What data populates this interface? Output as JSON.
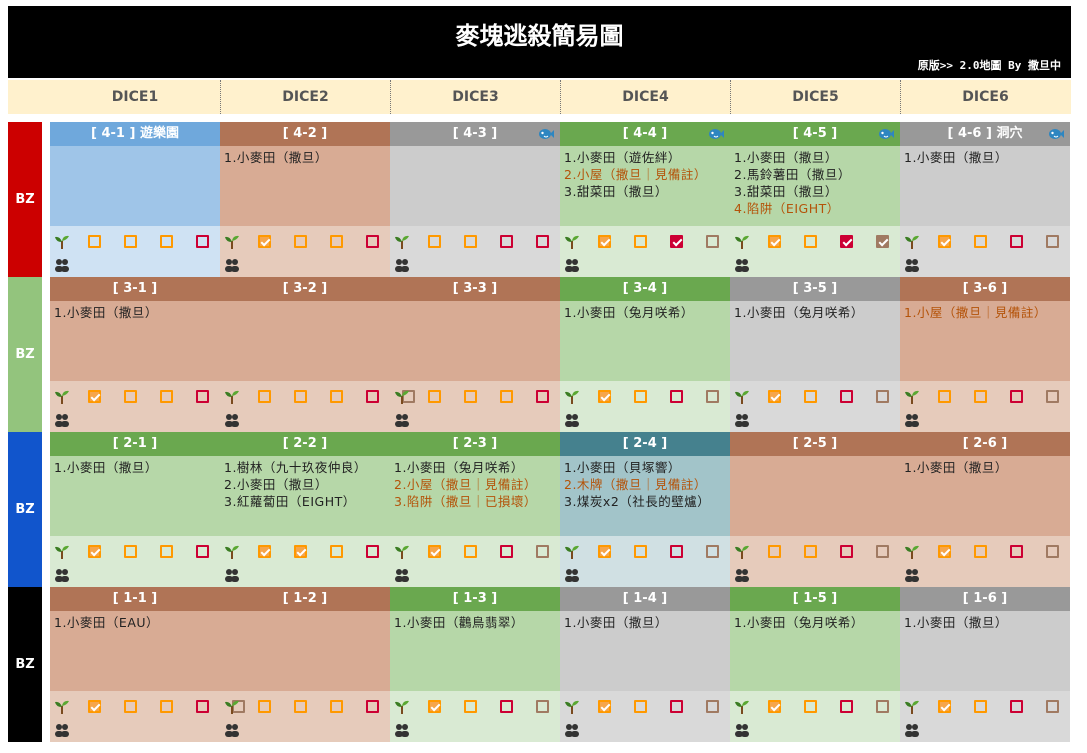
{
  "page": {
    "title": "麥塊逃殺簡易圖",
    "credit": "原版>> 2.0地圖 By 撒旦中"
  },
  "dice": [
    "DICE1",
    "DICE2",
    "DICE3",
    "DICE4",
    "DICE5",
    "DICE6"
  ],
  "colors": {
    "blue_hdr": "#6fa8dc",
    "blue_body": "#9fc5e8",
    "blue_foot": "#cfe2f3",
    "brown_hdr": "#b07456",
    "brown_body": "#d8ab94",
    "brown_foot": "#e6cbbb",
    "gray_hdr": "#999999",
    "gray_body": "#cccccc",
    "gray_foot": "#d9d9d9",
    "green_hdr": "#6aa84f",
    "green_body": "#b6d7a8",
    "green_foot": "#d9ead3",
    "teal_hdr": "#45818e",
    "teal_body": "#a2c4c9",
    "teal_foot": "#d0e0e3",
    "orange_box": "#ff9900",
    "orange_fill": "#f6a54b",
    "crimson_box": "#cc0033",
    "brown_box": "#a07a62"
  },
  "rows": [
    {
      "label": "BZ",
      "color": "#cc0000",
      "cells": [
        {
          "span": 1,
          "theme": "blue",
          "header": "[ 4-1 ] 遊樂園",
          "fish": false,
          "lines": [],
          "checks": [
            "checked-none",
            "orange",
            "orange",
            "crimson",
            "brown"
          ]
        },
        {
          "span": 1,
          "theme": "brown",
          "header": "[ 4-2 ]",
          "fish": false,
          "lines": [
            {
              "t": "1.小麥田（撒旦）",
              "c": "#222"
            }
          ],
          "checks": [
            "orange-checked",
            "orange",
            "orange",
            "crimson",
            "brown"
          ]
        },
        {
          "span": 1,
          "theme": "gray",
          "header": "[ 4-3 ]",
          "fish": true,
          "lines": [],
          "checks": [
            "orange",
            "orange",
            "crimson",
            "crimson",
            "brown"
          ]
        },
        {
          "span": 1,
          "theme": "green",
          "header": "[ 4-4 ]",
          "fish": true,
          "lines": [
            {
              "t": "1.小麥田（遊佐絆）",
              "c": "#222"
            },
            {
              "t": "2.小屋（撒旦｜見備註）",
              "c": "#b45309"
            },
            {
              "t": "3.甜菜田（撒旦）",
              "c": "#222"
            }
          ],
          "checks": [
            "orange-checked",
            "orange",
            "crimson-checked",
            "brown"
          ]
        },
        {
          "span": 1,
          "theme": "green",
          "header": "[ 4-5 ]",
          "fish": true,
          "lines": [
            {
              "t": "1.小麥田（撒旦）",
              "c": "#222"
            },
            {
              "t": "2.馬鈴薯田（撒旦）",
              "c": "#222"
            },
            {
              "t": "3.甜菜田（撒旦）",
              "c": "#222"
            },
            {
              "t": "4.陷阱（EIGHT）",
              "c": "#b45309"
            }
          ],
          "checks": [
            "orange-checked",
            "orange",
            "crimson-checked",
            "brown-checked"
          ]
        },
        {
          "span": 1,
          "theme": "gray",
          "header": "[ 4-6 ] 洞穴",
          "fish": true,
          "lines": [
            {
              "t": "1.小麥田（撒旦）",
              "c": "#222"
            }
          ],
          "checks": [
            "orange-checked",
            "orange",
            "crimson",
            "brown"
          ]
        }
      ]
    },
    {
      "label": "BZ",
      "color": "#93c47d",
      "cells": [
        {
          "span": 1,
          "theme": "brown",
          "header": "[ 3-1 ]",
          "fish": false,
          "lines": [
            {
              "t": "1.小麥田（撒旦）",
              "c": "#222"
            }
          ],
          "checks": [
            "orange-checked",
            "orange",
            "orange",
            "crimson",
            "brown"
          ]
        },
        {
          "span": 2,
          "theme": "brown",
          "header": "[ 3-2 ]",
          "fish": false,
          "lines": [],
          "checks": [
            "orange",
            "orange",
            "orange",
            "crimson",
            "brown"
          ],
          "extra_header": "[ 3-3 ]"
        },
        {
          "span": 1,
          "theme": "green",
          "header": "[ 3-4 ]",
          "fish": false,
          "lines": [
            {
              "t": "1.小麥田（兔月咲希）",
              "c": "#222"
            }
          ],
          "checks": [
            "orange-checked",
            "orange",
            "crimson",
            "brown"
          ]
        },
        {
          "span": 1,
          "theme": "gray",
          "header": "[ 3-5 ]",
          "fish": false,
          "lines": [
            {
              "t": "1.小麥田（兔月咲希）",
              "c": "#222"
            }
          ],
          "checks": [
            "orange-checked",
            "orange",
            "crimson",
            "brown"
          ]
        },
        {
          "span": 1,
          "theme": "brown",
          "header": "[ 3-6 ]",
          "fish": false,
          "lines": [
            {
              "t": "1.小屋（撒旦｜見備註）",
              "c": "#b45309"
            }
          ],
          "checks": [
            "orange",
            "orange",
            "crimson",
            "brown"
          ]
        }
      ]
    },
    {
      "label": "BZ",
      "color": "#1155cc",
      "cells": [
        {
          "span": 1,
          "theme": "green",
          "header": "[ 2-1 ]",
          "fish": false,
          "lines": [
            {
              "t": "1.小麥田（撒旦）",
              "c": "#222"
            }
          ],
          "checks": [
            "orange-checked",
            "orange",
            "orange",
            "crimson",
            "brown"
          ]
        },
        {
          "span": 1,
          "theme": "green",
          "header": "[ 2-2 ]",
          "fish": false,
          "lines": [
            {
              "t": "1.樹林（九十玖夜仲良）",
              "c": "#222"
            },
            {
              "t": "2.小麥田（撒旦）",
              "c": "#222"
            },
            {
              "t": "3.紅蘿蔔田（EIGHT）",
              "c": "#222"
            }
          ],
          "checks": [
            "orange-checked",
            "orange-checked",
            "orange",
            "crimson",
            "brown"
          ]
        },
        {
          "span": 1,
          "theme": "green",
          "header": "[ 2-3 ]",
          "fish": false,
          "lines": [
            {
              "t": "1.小麥田（兔月咲希）",
              "c": "#222"
            },
            {
              "t": "2.小屋（撒旦｜見備註）",
              "c": "#b45309"
            },
            {
              "t": "3.陷阱（撒旦｜已損壞）",
              "c": "#b45309"
            }
          ],
          "checks": [
            "orange-checked",
            "orange",
            "crimson",
            "brown"
          ]
        },
        {
          "span": 1,
          "theme": "teal",
          "header": "[ 2-4 ]",
          "fish": false,
          "lines": [
            {
              "t": "1.小麥田（貝塚響）",
              "c": "#222"
            },
            {
              "t": "2.木牌（撒旦｜見備註）",
              "c": "#b45309"
            },
            {
              "t": "3.煤炭x2（社長的壁爐）",
              "c": "#222"
            }
          ],
          "checks": [
            "orange-checked",
            "orange",
            "crimson",
            "brown"
          ]
        },
        {
          "span": 1,
          "theme": "brown",
          "header": "[ 2-5 ]",
          "fish": false,
          "lines": [],
          "checks": [
            "orange",
            "orange",
            "crimson",
            "brown"
          ]
        },
        {
          "span": 1,
          "theme": "brown",
          "header": "[ 2-6 ]",
          "fish": false,
          "lines": [
            {
              "t": "1.小麥田（撒旦）",
              "c": "#222"
            }
          ],
          "checks": [
            "orange-checked",
            "orange",
            "crimson",
            "brown"
          ]
        }
      ]
    },
    {
      "label": "BZ",
      "color": "#000000",
      "cells": [
        {
          "span": 2,
          "theme": "brown",
          "header": "[ 1-1 ]",
          "fish": false,
          "lines": [
            {
              "t": "1.小麥田（EAU）",
              "c": "#222"
            }
          ],
          "checks": [
            "orange-checked",
            "orange",
            "orange",
            "crimson",
            "brown"
          ],
          "extra_header": "[ 1-2 ]"
        },
        {
          "span": 1,
          "theme": "green",
          "header": "[ 1-3 ]",
          "fish": false,
          "lines": [
            {
              "t": "1.小麥田（鸛鳥翡翠）",
              "c": "#222"
            }
          ],
          "checks": [
            "orange-checked",
            "orange",
            "crimson",
            "brown"
          ]
        },
        {
          "span": 1,
          "theme": "gray",
          "header": "[ 1-4 ]",
          "fish": false,
          "lines": [
            {
              "t": "1.小麥田（撒旦）",
              "c": "#222"
            }
          ],
          "checks": [
            "orange-checked",
            "orange",
            "crimson",
            "brown"
          ]
        },
        {
          "span": 1,
          "theme": "green",
          "header": "[ 1-5 ]",
          "fish": false,
          "lines": [
            {
              "t": "1.小麥田（兔月咲希）",
              "c": "#222"
            }
          ],
          "checks": [
            "orange-checked",
            "orange",
            "crimson",
            "brown"
          ]
        },
        {
          "span": 1,
          "theme": "gray",
          "header": "[ 1-6 ]",
          "fish": false,
          "lines": [
            {
              "t": "1.小麥田（撒旦）",
              "c": "#222"
            }
          ],
          "checks": [
            "orange-checked",
            "orange",
            "crimson",
            "brown"
          ]
        }
      ]
    }
  ]
}
